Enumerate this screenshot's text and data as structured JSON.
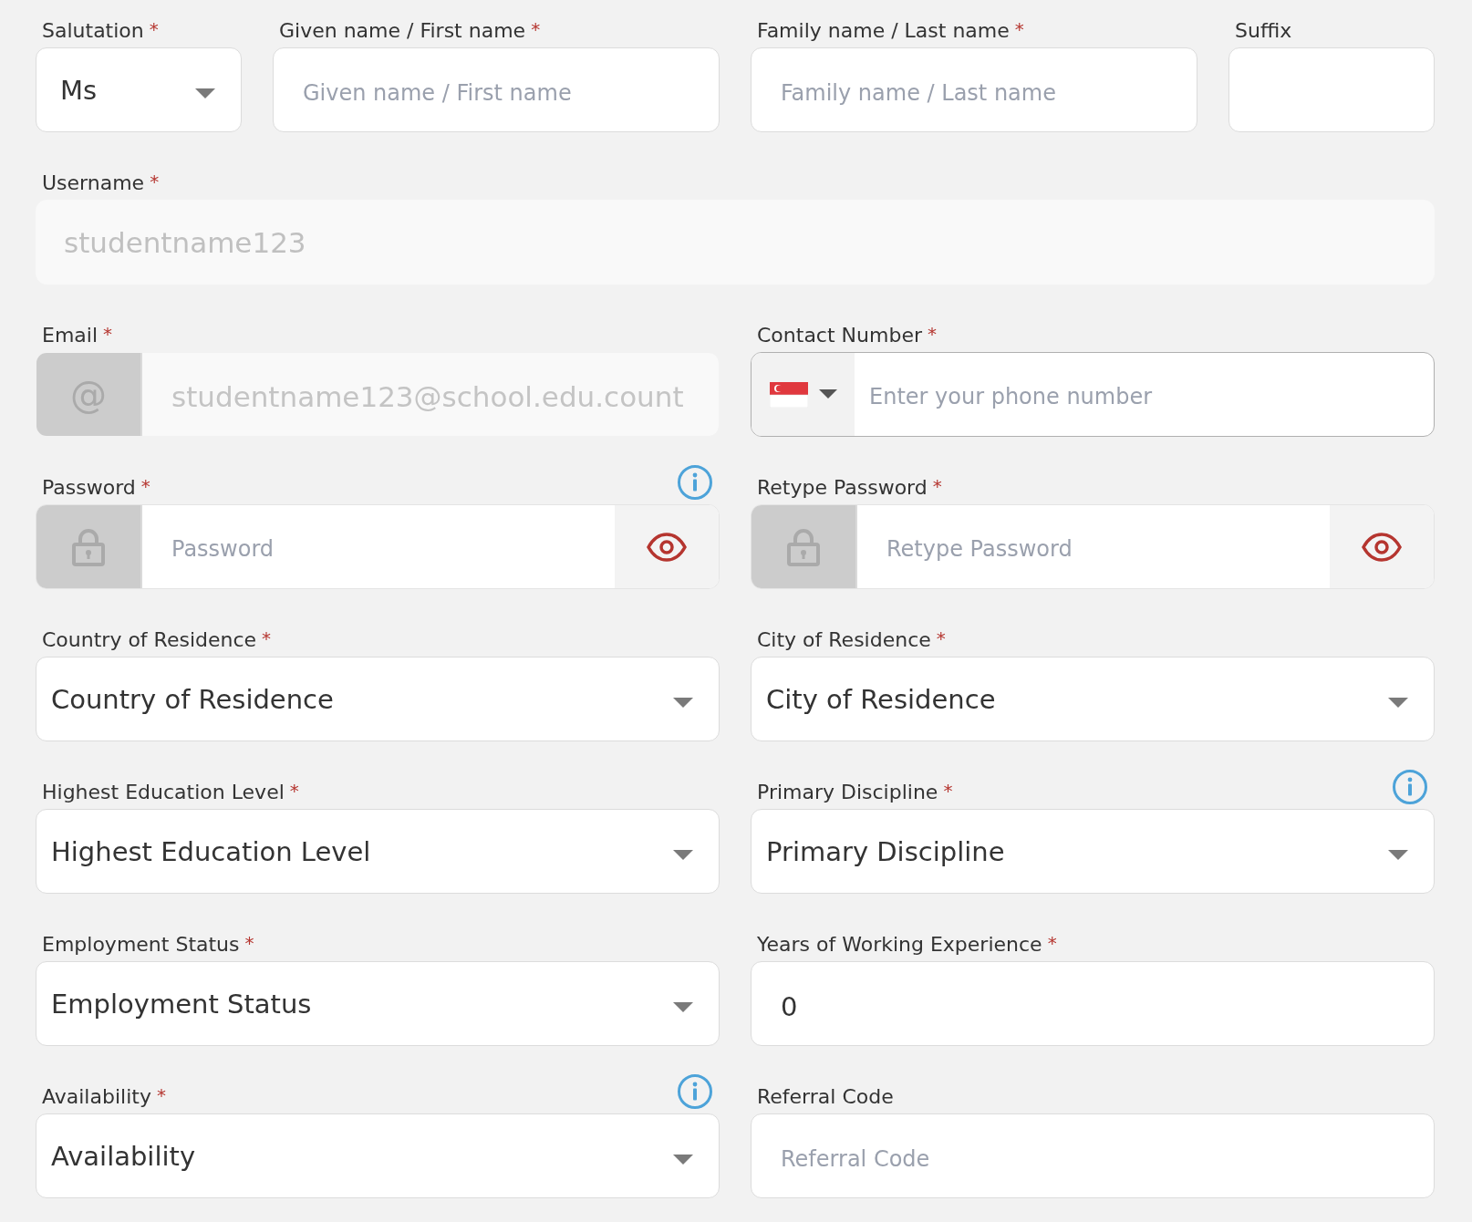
{
  "required_mark": "*",
  "rows": [
    {
      "fields": [
        {
          "kind": "select",
          "label": "Salutation",
          "required": true,
          "value": "Ms"
        },
        {
          "kind": "text",
          "label": "Given name / First name",
          "required": true,
          "placeholder": "Given name / First name"
        },
        {
          "kind": "text",
          "label": "Family name / Last name",
          "required": true,
          "placeholder": "Family name / Last name"
        },
        {
          "kind": "text",
          "label": "Suffix"
        }
      ]
    },
    {
      "fields": [
        {
          "kind": "text",
          "label": "Username",
          "required": true,
          "disabled": true,
          "value": "studentname123"
        }
      ]
    },
    {
      "fields": [
        {
          "kind": "email",
          "label": "Email",
          "required": true,
          "disabled": true,
          "prefix": "@",
          "value": "studentname123@school.edu.count"
        },
        {
          "kind": "phone",
          "label": "Contact Number",
          "required": true,
          "placeholder": "Enter your phone number"
        }
      ]
    },
    {
      "fields": [
        {
          "kind": "password",
          "label": "Password",
          "required": true,
          "info": true,
          "placeholder": "Password"
        },
        {
          "kind": "password",
          "label": "Retype Password",
          "required": true,
          "placeholder": "Retype Password"
        }
      ]
    },
    {
      "fields": [
        {
          "kind": "select",
          "label": "Country of Residence",
          "required": true,
          "value": "Country of Residence"
        },
        {
          "kind": "select",
          "label": "City of Residence",
          "required": true,
          "value": "City of Residence"
        }
      ]
    },
    {
      "fields": [
        {
          "kind": "select",
          "label": "Highest Education Level",
          "required": true,
          "value": "Highest Education Level"
        },
        {
          "kind": "select",
          "label": "Primary Discipline",
          "required": true,
          "info": true,
          "value": "Primary Discipline"
        }
      ]
    },
    {
      "fields": [
        {
          "kind": "select",
          "label": "Employment Status",
          "required": true,
          "value": "Employment Status"
        },
        {
          "kind": "text",
          "label": "Years of Working Experience",
          "required": true,
          "value": "0"
        }
      ]
    },
    {
      "fields": [
        {
          "kind": "select",
          "label": "Availability",
          "required": true,
          "info": true,
          "value": "Availability"
        },
        {
          "kind": "text",
          "label": "Referral Code",
          "placeholder": "Referral Code"
        }
      ]
    }
  ]
}
